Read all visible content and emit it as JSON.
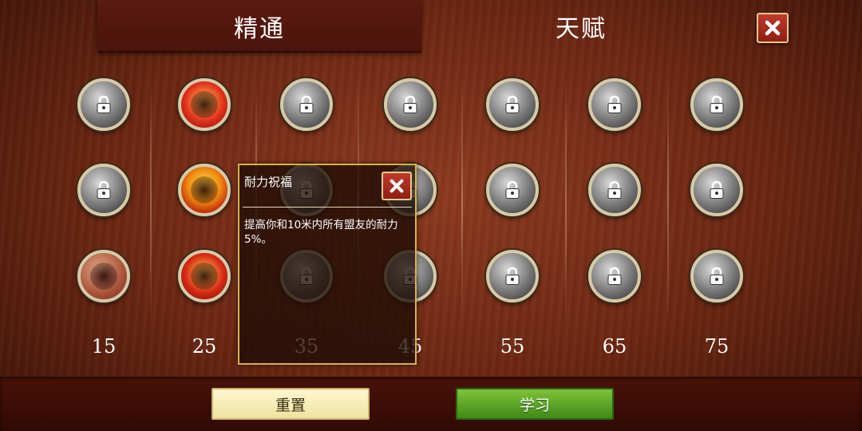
{
  "tabs": {
    "mastery_label": "精通",
    "talent_label": "天赋"
  },
  "colors": {
    "background": "#6a2612",
    "tab_active": "#4f160c",
    "close_button": "#b3321f",
    "learn_button": "#5ea626",
    "reset_button": "#f7eab8",
    "popup_border": "#d8b24a"
  },
  "skill_columns": [
    {
      "level": "15",
      "skills": [
        {
          "icon": "locked-dash-icon",
          "locked": true
        },
        {
          "icon": "locked-sword-icon",
          "locked": true
        },
        {
          "icon": "sprint-rune-icon",
          "locked": false
        }
      ]
    },
    {
      "level": "25",
      "skills": [
        {
          "icon": "rage-scream-icon",
          "locked": false
        },
        {
          "icon": "endurance-blessing-icon",
          "locked": false
        },
        {
          "icon": "flame-helm-icon",
          "locked": false
        }
      ]
    },
    {
      "level": "35",
      "skills": [
        {
          "icon": "locked-claw-icon",
          "locked": true
        },
        {
          "icon": "locked-gear-icon",
          "locked": true
        },
        {
          "icon": "locked-spike-icon",
          "locked": true
        }
      ]
    },
    {
      "level": "45",
      "skills": [
        {
          "icon": "locked-whirl-icon",
          "locked": true
        },
        {
          "icon": "locked-beast-icon",
          "locked": true
        },
        {
          "icon": "locked-demon-icon",
          "locked": true
        }
      ]
    },
    {
      "level": "55",
      "skills": [
        {
          "icon": "locked-hammer-icon",
          "locked": true
        },
        {
          "icon": "locked-wheel-icon",
          "locked": true
        },
        {
          "icon": "locked-fist-icon",
          "locked": true
        }
      ]
    },
    {
      "level": "65",
      "skills": [
        {
          "icon": "locked-slash-icon",
          "locked": true
        },
        {
          "icon": "locked-shield-icon",
          "locked": true
        },
        {
          "icon": "locked-target-icon",
          "locked": true
        }
      ]
    },
    {
      "level": "75",
      "skills": [
        {
          "icon": "locked-wing-icon",
          "locked": true
        },
        {
          "icon": "locked-strike-icon",
          "locked": true
        },
        {
          "icon": "locked-spirit-icon",
          "locked": true
        }
      ]
    }
  ],
  "popup": {
    "title": "耐力祝福",
    "description": "提高你和10米内所有盟友的耐力5%。"
  },
  "buttons": {
    "reset_label": "重置",
    "learn_label": "学习"
  }
}
